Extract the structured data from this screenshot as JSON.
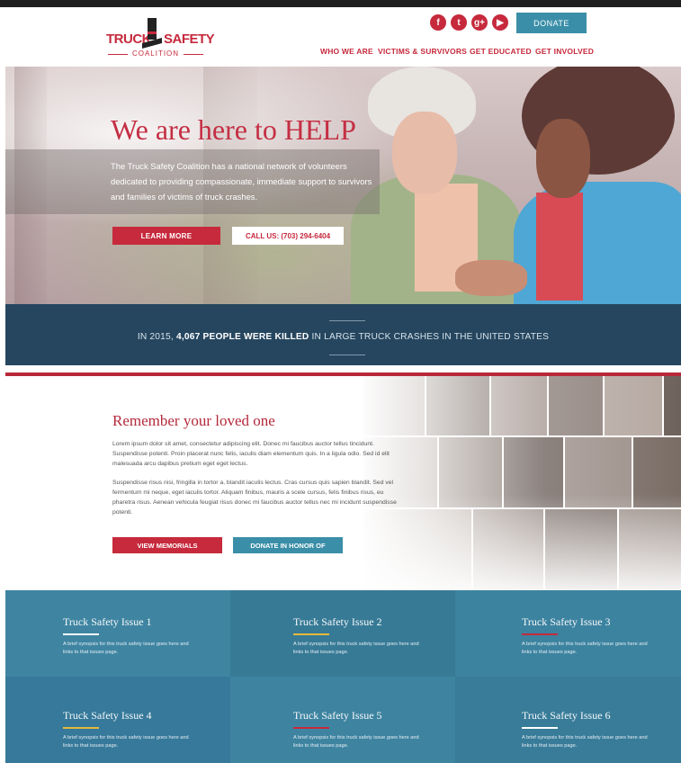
{
  "header": {
    "logo": {
      "word1": "TRUCK",
      "word2": "SAFETY",
      "sub": "COALITION"
    },
    "social": [
      {
        "icon": "facebook-icon",
        "glyph": "f"
      },
      {
        "icon": "twitter-icon",
        "glyph": "t"
      },
      {
        "icon": "googleplus-icon",
        "glyph": "g+"
      },
      {
        "icon": "youtube-icon",
        "glyph": "▶"
      }
    ],
    "donate_label": "DONATE",
    "nav": [
      "WHO WE ARE",
      "VICTIMS & SURVIVORS",
      "GET EDUCATED",
      "GET INVOLVED"
    ]
  },
  "hero": {
    "title": "We are here to HELP",
    "text": "The Truck Safety Coalition has a national network of volunteers dedicated to providing compassionate, immediate support to survivors and families of victims of truck crashes.",
    "learn_more": "LEARN MORE",
    "call_us": "CALL US: (703) 294-6404"
  },
  "stat": {
    "prefix": "IN 2015,",
    "bold": "4,067 PEOPLE WERE KILLED",
    "suffix": "IN LARGE TRUCK CRASHES IN THE UNITED STATES"
  },
  "remember": {
    "title": "Remember your loved one",
    "p1": "Lorem ipsum dolor sit amet, consectetur adipiscing elit. Donec mi faucibus auctor tellus tincidunt. Suspendisse potenti. Proin placerat nunc felis, iaculis diam elementum quis. In a ligula odio. Sed id elit malesuada arcu dapibus pretium eget eget lectus.",
    "p2": "Suspendisse risus nisi, fringilla in tortor a, blandit iaculis lectus. Cras cursus quis sapien blandit. Sed vel fermentum mi neque, eget iaculis tortor. Aliquam finibus, mauris a scele cursus, felis finibus risus, eu pharetra risus. Aenean vehicula feugiat risus donec mi faucibus auctor tellus nec mi incidunt suspendisse potenti.",
    "view_memorials": "VIEW MEMORIALS",
    "donate_honor": "DONATE IN HONOR OF"
  },
  "issues": [
    {
      "title": "Truck Safety Issue 1",
      "line_color": "#ffffff",
      "desc": "A brief synopsis for this truck safety issue goes here and links to that issues page."
    },
    {
      "title": "Truck Safety Issue 2",
      "line_color": "#e5b93a",
      "desc": "A brief synopsis for this truck safety issue goes here and links to that issues page."
    },
    {
      "title": "Truck Safety Issue 3",
      "line_color": "#c62a3c",
      "desc": "A brief synopsis for this truck safety issue goes here and links to that issues page."
    },
    {
      "title": "Truck Safety Issue 4",
      "line_color": "#e5b93a",
      "desc": "A brief synopsis for this truck safety issue goes here and links to that issues page."
    },
    {
      "title": "Truck Safety Issue 5",
      "line_color": "#c62a3c",
      "desc": "A brief synopsis for this truck safety issue goes here and links to that issues page."
    },
    {
      "title": "Truck Safety Issue 6",
      "line_color": "#ffffff",
      "desc": "A brief synopsis for this truck safety issue goes here and links to that issues page."
    }
  ],
  "colors": {
    "brand_red": "#c62a3c",
    "accent_blue": "#3a8ea8",
    "band_navy": "#26465f",
    "issues_bg": "#3a7f9c"
  }
}
